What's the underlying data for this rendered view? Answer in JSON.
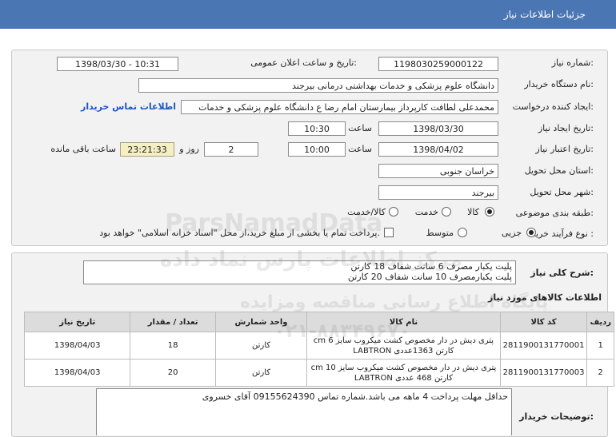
{
  "header": {
    "title": "جزئیات اطلاعات نیاز"
  },
  "fields": {
    "need_number_label": "شماره نیاز:",
    "need_number": "1198030259000122",
    "announce_label": "تاریخ و ساعت اعلان عمومی:",
    "announce_value": "1398/03/30 - 10:31",
    "buyer_label": "نام دستگاه خریدار:",
    "buyer_value": "دانشگاه علوم پزشکی و خدمات بهداشتی درمانی بیرجند",
    "requester_label": "ایجاد کننده درخواست:",
    "requester_value": "محمدعلی لطافت کارپرداز بیمارستان امام رضا ع دانشگاه علوم پزشکی و خدمات",
    "contact_link": "اطلاعات تماس خریدار",
    "created_label": "تاریخ ایجاد نیاز:",
    "created_date": "1398/03/30",
    "time_label": "ساعت",
    "created_time": "10:30",
    "validity_label": "تاریخ اعتبار نیاز:",
    "validity_date": "1398/04/02",
    "validity_time": "10:00",
    "days_value": "2",
    "days_label": "روز و",
    "remaining_time": "23:21:33",
    "remaining_label": "ساعت باقی مانده",
    "province_label": "استان محل تحویل:",
    "province_value": "خراسان جنوبی",
    "city_label": "شهر محل تحویل:",
    "city_value": "بیرجند",
    "category_label": "طبقه بندی موضوعی:",
    "category_options": [
      "کالا",
      "خدمت",
      "کالا/خدمت"
    ],
    "process_label": "نوع فرآیند خرید :",
    "process_options": [
      "جزیی",
      "متوسط"
    ],
    "payment_note": "پرداخت تمام یا بخشی از مبلغ خرید،از محل \"اسناد خزانه اسلامی\" خواهد بود."
  },
  "summary": {
    "label": "شرح کلی نیاز:",
    "lines": [
      "پلیت یکبار مصرف 6 سانت شفاف 18 کارتن",
      "پلیت یکبارمصرف 10 سانت شفاف 20 کارتن"
    ]
  },
  "items_title": "اطلاعات کالاهای مورد نیاز",
  "table": {
    "headers": [
      "ردیف",
      "کد کالا",
      "نام کالا",
      "واحد شمارش",
      "تعداد / مقدار",
      "تاریخ نیاز"
    ],
    "rows": [
      [
        "1",
        "2811900131770001",
        "پتری دیش در دار مخصوص کشت میکروب سایز cm 6 کارتن 1363عددی LABTRON",
        "کارتن",
        "18",
        "1398/04/03"
      ],
      [
        "2",
        "2811900131770003",
        "پتری دیش در دار مخصوص کشت میکروب سایز cm 10 کارتن 468 عددی LABTRON",
        "کارتن",
        "20",
        "1398/04/03"
      ]
    ]
  },
  "notes": {
    "label": "توضیحات خریدار:",
    "text": "حداقل مهلت پرداخت 4 ماهه می باشد.شماره تماس 09155624390 آقای خسروی"
  },
  "watermark": {
    "brand": "ParsNamadData",
    "line1": "مرکز اطلاعات پارس نماد داده",
    "line2": "پایگاه اطلاع رسانی مناقصه ومزایده",
    "phone": "۰۲۱-۸۸۳۴۹۶۷۰"
  }
}
